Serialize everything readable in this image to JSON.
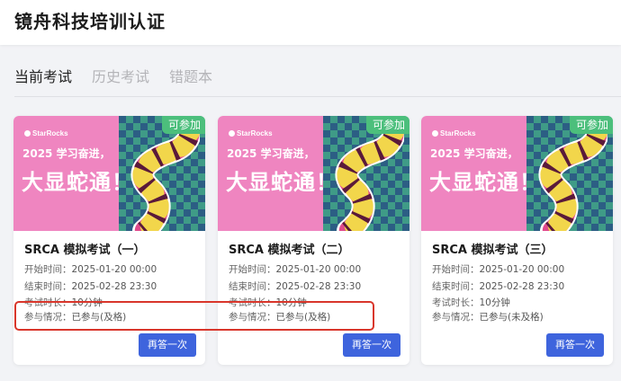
{
  "header": {
    "title": "镜舟科技培训认证"
  },
  "tabs": [
    {
      "label": "当前考试",
      "active": true
    },
    {
      "label": "历史考试",
      "active": false
    },
    {
      "label": "错题本",
      "active": false
    }
  ],
  "banner": {
    "brand": "StarRocks",
    "line1": "2025 学习奋进，",
    "line2": "大显蛇通！"
  },
  "labels": {
    "start": "开始时间：",
    "end": "结束时间：",
    "duration": "考试时长：",
    "status": "参与情况："
  },
  "cards": [
    {
      "badge": "可参加",
      "title": "SRCA 模拟考试（一）",
      "start": "2025-01-20 00:00",
      "end": "2025-02-28 23:30",
      "duration": "10分钟",
      "status": "已参与(及格)",
      "button": "再答一次"
    },
    {
      "badge": "可参加",
      "title": "SRCA 模拟考试（二）",
      "start": "2025-01-20 00:00",
      "end": "2025-02-28 23:30",
      "duration": "10分钟",
      "status": "已参与(及格)",
      "button": "再答一次"
    },
    {
      "badge": "可参加",
      "title": "SRCA 模拟考试（三）",
      "start": "2025-01-20 00:00",
      "end": "2025-02-28 23:30",
      "duration": "10分钟",
      "status": "已参与(未及格)",
      "button": "再答一次"
    }
  ],
  "colors": {
    "primary": "#3e64dd",
    "badge": "#4cbf7c",
    "highlight": "#d9362b",
    "banner_pink": "#ef85c0"
  }
}
